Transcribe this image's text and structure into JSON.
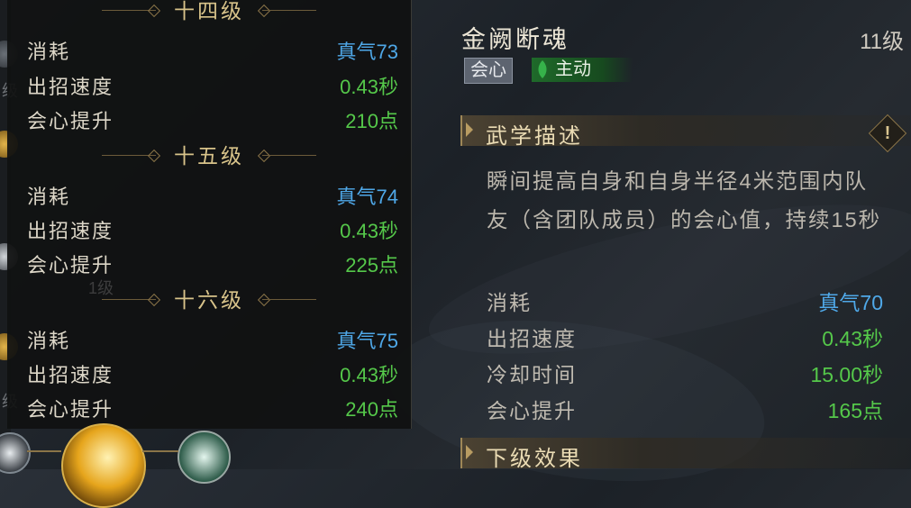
{
  "level_panel": {
    "levels": [
      {
        "title": "十四级",
        "stats": [
          {
            "label": "消耗",
            "value": "真气73",
            "color": "blue"
          },
          {
            "label": "出招速度",
            "value": "0.43秒",
            "color": "green"
          },
          {
            "label": "会心提升",
            "value": "210点",
            "color": "green"
          }
        ]
      },
      {
        "title": "十五级",
        "stats": [
          {
            "label": "消耗",
            "value": "真气74",
            "color": "blue"
          },
          {
            "label": "出招速度",
            "value": "0.43秒",
            "color": "green"
          },
          {
            "label": "会心提升",
            "value": "225点",
            "color": "green"
          }
        ]
      },
      {
        "title": "十六级",
        "stats": [
          {
            "label": "消耗",
            "value": "真气75",
            "color": "blue"
          },
          {
            "label": "出招速度",
            "value": "0.43秒",
            "color": "green"
          },
          {
            "label": "会心提升",
            "value": "240点",
            "color": "green"
          }
        ]
      }
    ]
  },
  "background_labels": {
    "level_a": "级",
    "level_b": "1级",
    "level_c": "级"
  },
  "skill": {
    "name": "金阙断魂",
    "level": "11级",
    "tags": {
      "type": "会心",
      "mode": "主动"
    },
    "section_desc_title": "武学描述",
    "description": "瞬间提高自身和自身半径4米范围内队友（含团队成员）的会心值，持续15秒",
    "stats": [
      {
        "label": "消耗",
        "value": "真气70",
        "color": "blue"
      },
      {
        "label": "出招速度",
        "value": "0.43秒",
        "color": "green"
      },
      {
        "label": "冷却时间",
        "value": "15.00秒",
        "color": "green"
      },
      {
        "label": "会心提升",
        "value": "165点",
        "color": "green"
      }
    ],
    "section_next_title": "下级效果",
    "warn_icon": "!"
  },
  "colors": {
    "blue": "#4fa8e8",
    "green": "#55c84a",
    "gold": "#d8c38a"
  }
}
